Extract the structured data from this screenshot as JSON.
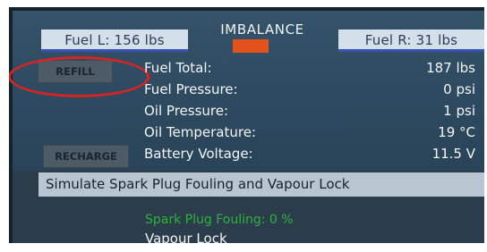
{
  "imbalance": {
    "label": "IMBALANCE",
    "bar_color": "#e1521c"
  },
  "fuel_left": {
    "label": "Fuel L: 156 lbs"
  },
  "fuel_right": {
    "label": "Fuel R: 31 lbs"
  },
  "buttons": {
    "refill": "REFILL",
    "recharge": "RECHARGE"
  },
  "readouts": [
    {
      "label": "Fuel Total:",
      "value": "187 lbs"
    },
    {
      "label": "Fuel Pressure:",
      "value": "0 psi"
    },
    {
      "label": "Oil Pressure:",
      "value": "1 psi"
    },
    {
      "label": "Oil Temperature:",
      "value": "19 °C"
    },
    {
      "label": "Battery Voltage:",
      "value": "11.5 V"
    }
  ],
  "simulate": {
    "title": "Simulate Spark Plug Fouling and Vapour Lock",
    "spark_plug_fouling": "Spark Plug Fouling: 0 %",
    "vapour_lock": "Vapour Lock"
  },
  "colors": {
    "panel_bg": "#2e4a60",
    "highlight_ellipse": "#d42525",
    "spark_text": "#2fb03f",
    "fuel_underline": "#3a52b3"
  }
}
